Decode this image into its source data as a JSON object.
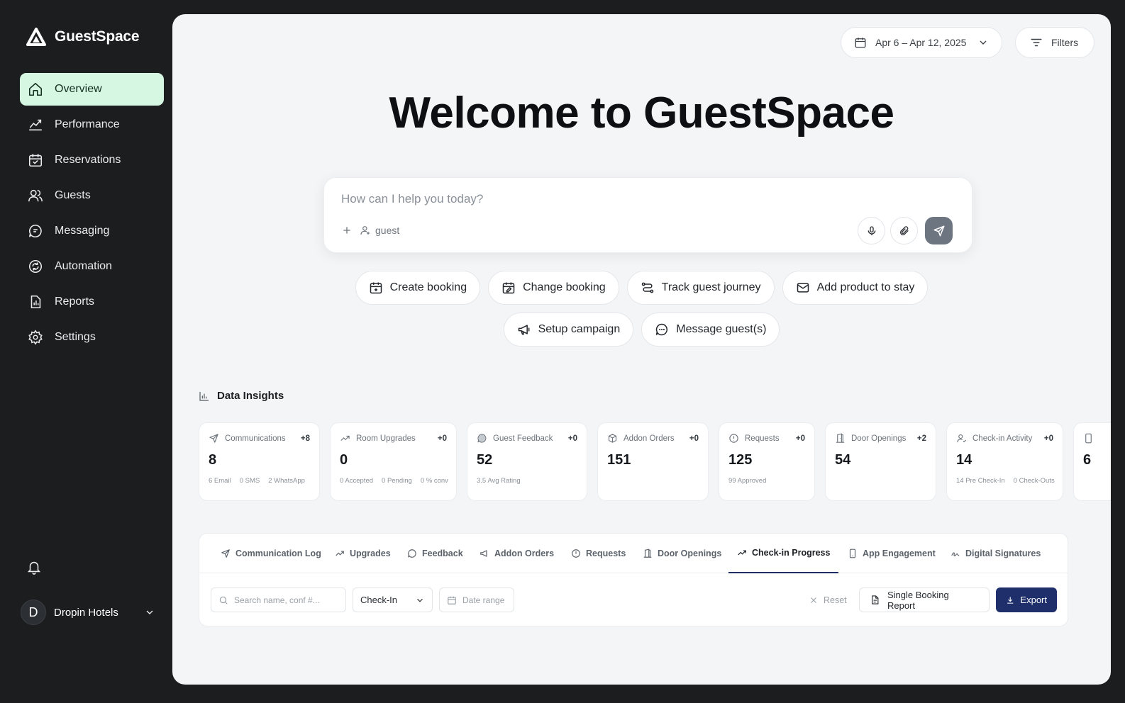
{
  "app": {
    "name": "GuestSpace",
    "accent": "#d6f8e3",
    "primary": "#1f2f6b"
  },
  "sidebar": {
    "items": [
      {
        "label": "Overview",
        "icon": "home-icon",
        "active": true
      },
      {
        "label": "Performance",
        "icon": "chart-line-icon"
      },
      {
        "label": "Reservations",
        "icon": "calendar-check-icon"
      },
      {
        "label": "Guests",
        "icon": "users-icon"
      },
      {
        "label": "Messaging",
        "icon": "chat-bubble-icon"
      },
      {
        "label": "Automation",
        "icon": "automation-icon"
      },
      {
        "label": "Reports",
        "icon": "report-icon"
      },
      {
        "label": "Settings",
        "icon": "gear-icon"
      }
    ],
    "account": {
      "initial": "D",
      "name": "Dropin Hotels"
    }
  },
  "header": {
    "date_range": "Apr 6 – Apr 12, 2025",
    "filters_label": "Filters"
  },
  "hero": {
    "title": "Welcome to GuestSpace",
    "prompt_placeholder": "How can I help you today?",
    "prompt_tag": "guest"
  },
  "quick_actions": [
    "Create booking",
    "Change booking",
    "Track guest journey",
    "Add product to stay",
    "Setup campaign",
    "Message guest(s)"
  ],
  "insights": {
    "title": "Data Insights",
    "cards": [
      {
        "label": "Communications",
        "delta": "+8",
        "value": "8",
        "sub": [
          "6 Email",
          "0 SMS",
          "2 WhatsApp"
        ]
      },
      {
        "label": "Room Upgrades",
        "delta": "+0",
        "value": "0",
        "sub": [
          "0 Accepted",
          "0 Pending",
          "0 % conv"
        ]
      },
      {
        "label": "Guest Feedback",
        "delta": "+0",
        "value": "52",
        "sub": [
          "3.5 Avg Rating"
        ]
      },
      {
        "label": "Addon Orders",
        "delta": "+0",
        "value": "151",
        "sub": []
      },
      {
        "label": "Requests",
        "delta": "+0",
        "value": "125",
        "sub": [
          "99 Approved"
        ]
      },
      {
        "label": "Door Openings",
        "delta": "+2",
        "value": "54",
        "sub": []
      },
      {
        "label": "Check-in Activity",
        "delta": "+0",
        "value": "14",
        "sub": [
          "14 Pre Check-In",
          "0 Check-Outs"
        ]
      },
      {
        "label": "",
        "delta": "",
        "value": "6",
        "sub": []
      }
    ]
  },
  "tabs": [
    {
      "label": "Communication Log"
    },
    {
      "label": "Upgrades"
    },
    {
      "label": "Feedback"
    },
    {
      "label": "Addon Orders"
    },
    {
      "label": "Requests"
    },
    {
      "label": "Door Openings"
    },
    {
      "label": "Check-in Progress",
      "active": true
    },
    {
      "label": "App Engagement"
    },
    {
      "label": "Digital Signatures"
    }
  ],
  "table_tools": {
    "search_placeholder": "Search name, conf #...",
    "select_value": "Check-In",
    "date_placeholder": "Date range",
    "reset_label": "Reset",
    "report_label": "Single Booking Report",
    "export_label": "Export"
  }
}
